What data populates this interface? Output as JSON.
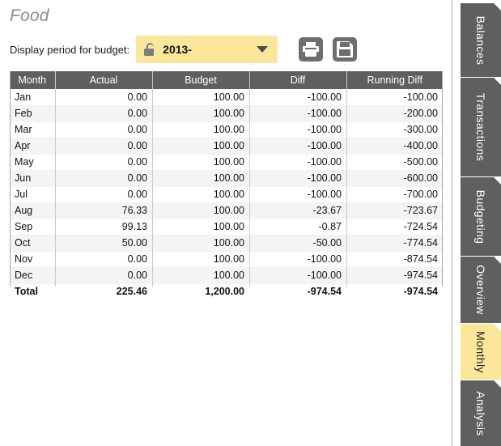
{
  "page": {
    "title": "Food"
  },
  "toolbar": {
    "period_label": "Display period for budget:",
    "period_value": "2013-",
    "lock_icon": "unlocked-padlock-icon",
    "dropdown_icon": "chevron-down-icon",
    "print_button_label": "printer-icon",
    "save_button_label": "save-floppy-icon"
  },
  "table": {
    "columns": [
      "Month",
      "Actual",
      "Budget",
      "Diff",
      "Running Diff"
    ],
    "rows": [
      {
        "month": "Jan",
        "actual": "0.00",
        "budget": "100.00",
        "diff": "-100.00",
        "running_diff": "-100.00"
      },
      {
        "month": "Feb",
        "actual": "0.00",
        "budget": "100.00",
        "diff": "-100.00",
        "running_diff": "-200.00"
      },
      {
        "month": "Mar",
        "actual": "0.00",
        "budget": "100.00",
        "diff": "-100.00",
        "running_diff": "-300.00"
      },
      {
        "month": "Apr",
        "actual": "0.00",
        "budget": "100.00",
        "diff": "-100.00",
        "running_diff": "-400.00"
      },
      {
        "month": "May",
        "actual": "0.00",
        "budget": "100.00",
        "diff": "-100.00",
        "running_diff": "-500.00"
      },
      {
        "month": "Jun",
        "actual": "0.00",
        "budget": "100.00",
        "diff": "-100.00",
        "running_diff": "-600.00"
      },
      {
        "month": "Jul",
        "actual": "0.00",
        "budget": "100.00",
        "diff": "-100.00",
        "running_diff": "-700.00"
      },
      {
        "month": "Aug",
        "actual": "76.33",
        "budget": "100.00",
        "diff": "-23.67",
        "running_diff": "-723.67"
      },
      {
        "month": "Sep",
        "actual": "99.13",
        "budget": "100.00",
        "diff": "-0.87",
        "running_diff": "-724.54"
      },
      {
        "month": "Oct",
        "actual": "50.00",
        "budget": "100.00",
        "diff": "-50.00",
        "running_diff": "-774.54"
      },
      {
        "month": "Nov",
        "actual": "0.00",
        "budget": "100.00",
        "diff": "-100.00",
        "running_diff": "-874.54"
      },
      {
        "month": "Dec",
        "actual": "0.00",
        "budget": "100.00",
        "diff": "-100.00",
        "running_diff": "-974.54"
      }
    ],
    "total": {
      "month": "Total",
      "actual": "225.46",
      "budget": "1,200.00",
      "diff": "-974.54",
      "running_diff": "-974.54"
    }
  },
  "tabs": [
    {
      "label": "Balances",
      "active": false
    },
    {
      "label": "Transactions",
      "active": false
    },
    {
      "label": "Budgeting",
      "active": false
    },
    {
      "label": "Overview",
      "active": false
    },
    {
      "label": "Monthly",
      "active": true
    },
    {
      "label": "Analysis",
      "active": false
    }
  ],
  "colors": {
    "header_gray": "#5f5f5f",
    "accent_yellow": "#fbe79a",
    "title_gray": "#8d8d8d",
    "alt_row": "#f4f4f4"
  }
}
